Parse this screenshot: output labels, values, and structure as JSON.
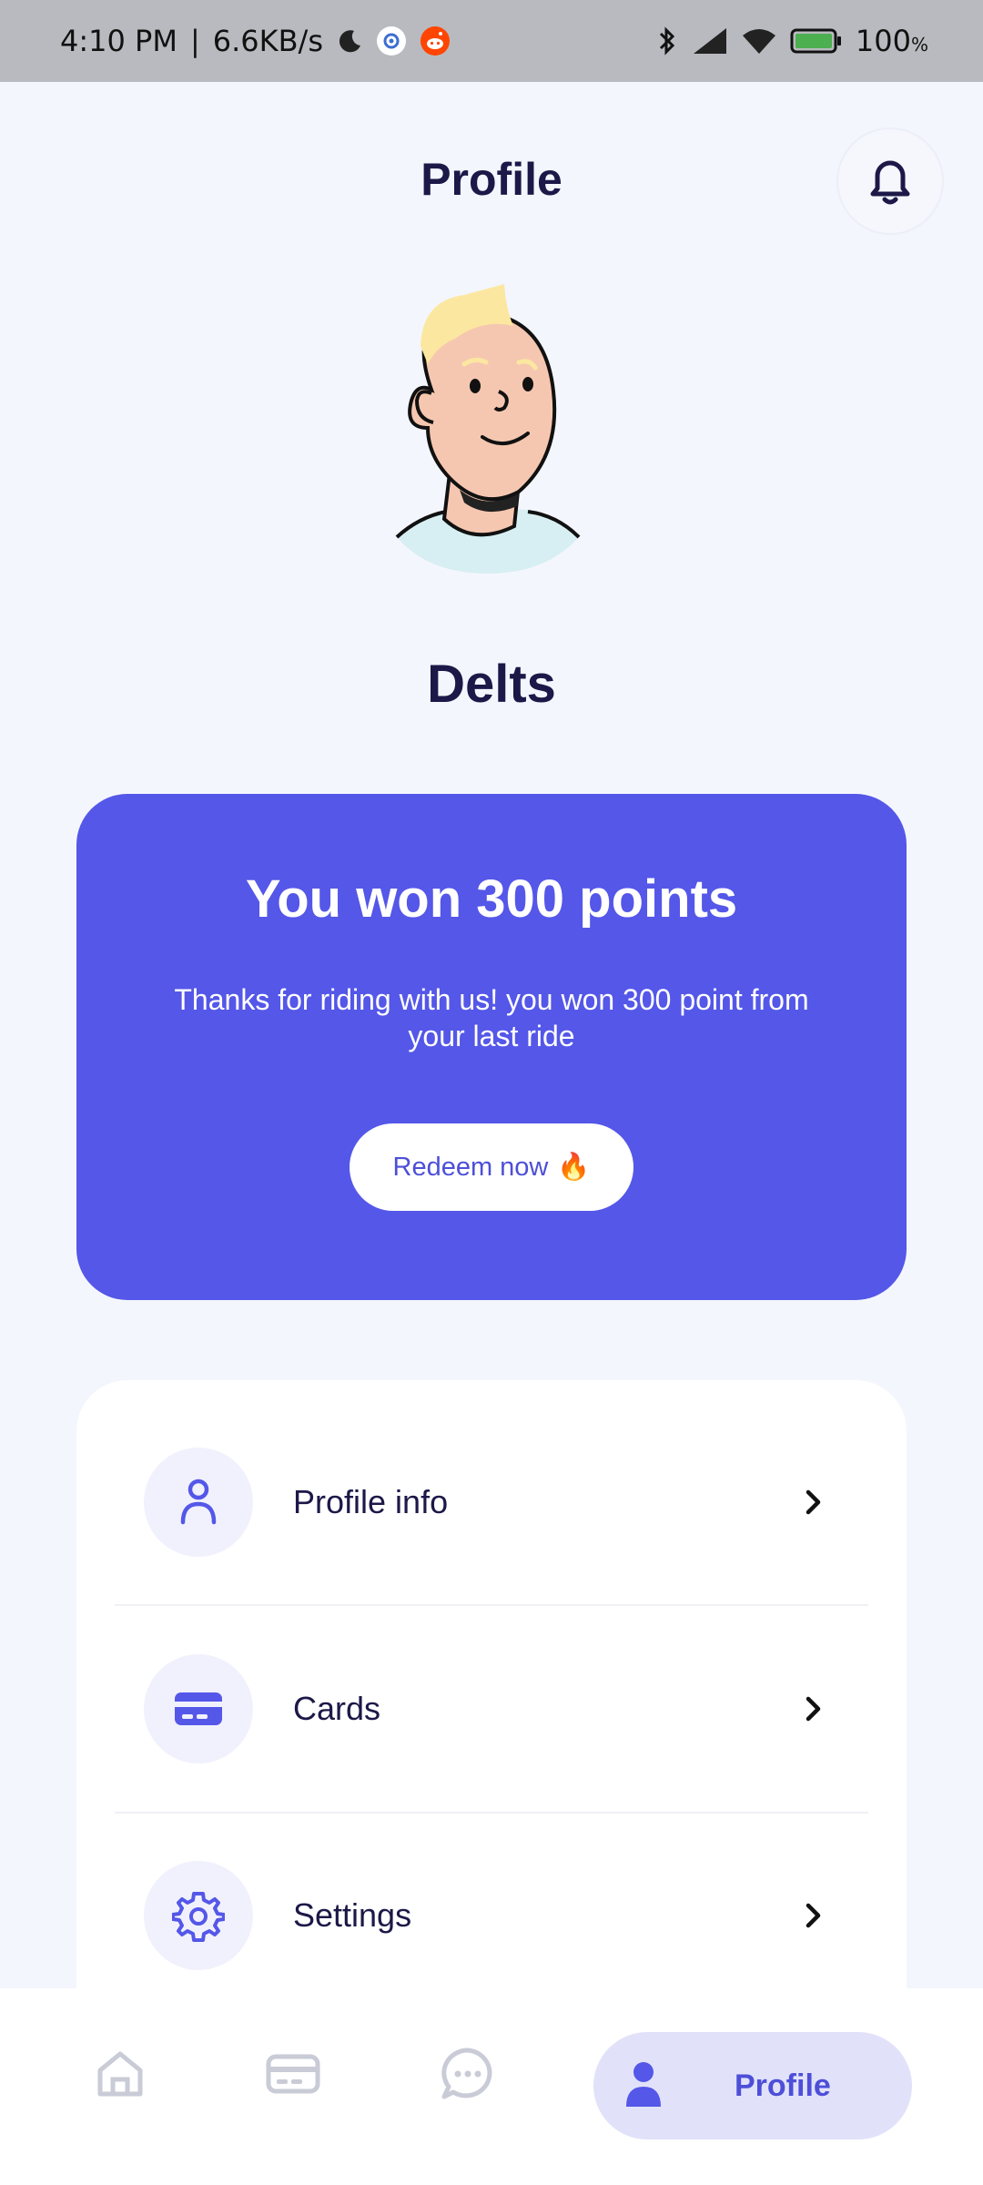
{
  "status_bar": {
    "time": "4:10 PM",
    "net_speed": "6.6KB/s",
    "battery": "100"
  },
  "header": {
    "title": "Profile"
  },
  "user": {
    "name": "Delts"
  },
  "points_card": {
    "title": "You won 300 points",
    "description": "Thanks for riding with us! you won 300 point from your last ride",
    "redeem_label": "Redeem now",
    "redeem_emoji": "🔥"
  },
  "menu": {
    "items": [
      {
        "label": "Profile info",
        "icon": "person-icon"
      },
      {
        "label": "Cards",
        "icon": "card-icon"
      },
      {
        "label": "Settings",
        "icon": "gear-icon"
      }
    ]
  },
  "bottom_nav": {
    "items": [
      {
        "icon": "home-icon"
      },
      {
        "icon": "card-icon"
      },
      {
        "icon": "chat-icon"
      },
      {
        "icon": "person-icon",
        "label": "Profile",
        "active": true
      }
    ]
  },
  "colors": {
    "accent": "#5457e8",
    "background": "#f4f6fe",
    "text": "#1c1848"
  }
}
